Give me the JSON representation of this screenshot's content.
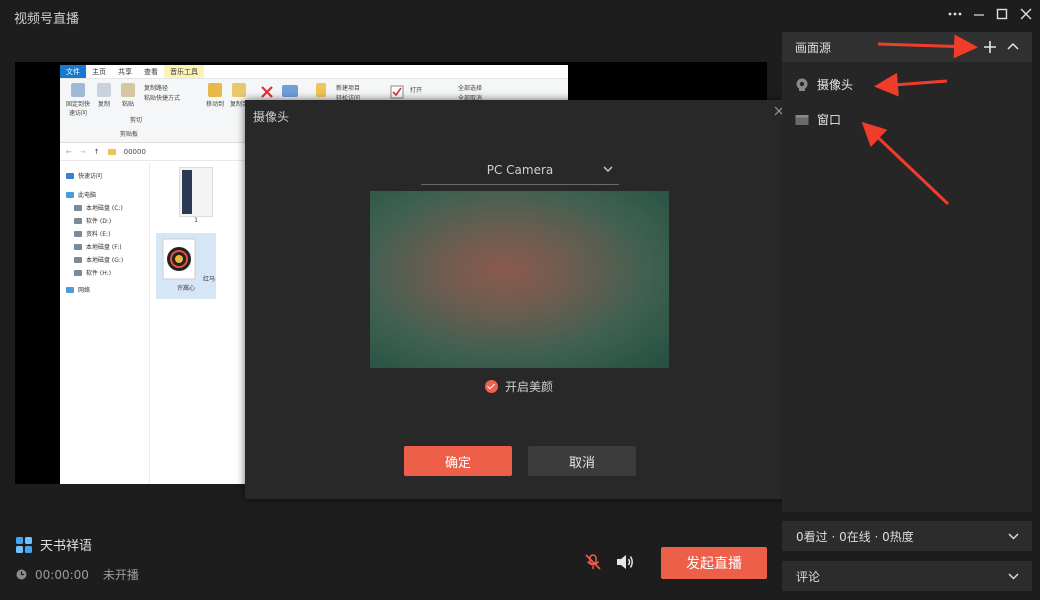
{
  "app": {
    "title": "视频号直播"
  },
  "window_controls": {
    "more": "···",
    "minimize": "−",
    "maximize": "□",
    "close": "✕"
  },
  "explorer": {
    "tabs": [
      "文件",
      "主页",
      "共享",
      "查看",
      "音乐工具"
    ],
    "ribbon": {
      "pin": "固定到快速访问",
      "copy": "复制",
      "paste": "粘贴",
      "copy_path": "复制路径",
      "paste_shortcut": "粘贴快捷方式",
      "cut": "剪切",
      "clipboard": "剪贴板",
      "move_to": "移动到",
      "copy_to": "复制到",
      "new_item": "新建项目",
      "easy_access": "轻松访问",
      "open": "打开",
      "select_all": "全部选择",
      "select_none": "全部取消"
    },
    "address": "00000",
    "nav": [
      "快速访问",
      "此电脑",
      "本地磁盘 (C:)",
      "软件 (D:)",
      "资料 (E:)",
      "本地磁盘 (F:)",
      "本地磁盘 (G:)",
      "软件 (H:)",
      "网络"
    ],
    "files": [
      {
        "name": "1"
      },
      {
        "name": "红马 许嵩心"
      }
    ]
  },
  "dialog": {
    "title": "摄像头",
    "close": "×",
    "camera_select": "PC Camera",
    "beauty_label": "开启美颜",
    "beauty_checked": true,
    "confirm": "确定",
    "cancel": "取消"
  },
  "sources": {
    "title": "画面源",
    "items": [
      {
        "label": "摄像头",
        "icon": "camera-icon"
      },
      {
        "label": "窗口",
        "icon": "window-icon"
      }
    ]
  },
  "stats": {
    "text": "0看过 · 0在线 · 0热度"
  },
  "comments": {
    "label": "评论"
  },
  "user": {
    "name": "天书祥语"
  },
  "status": {
    "time": "00:00:00",
    "state": "未开播"
  },
  "actions": {
    "go_live": "发起直播"
  },
  "colors": {
    "accent": "#ee5f4a",
    "background": "#1d1d1d",
    "annotation_arrow": "#f23c2a"
  }
}
